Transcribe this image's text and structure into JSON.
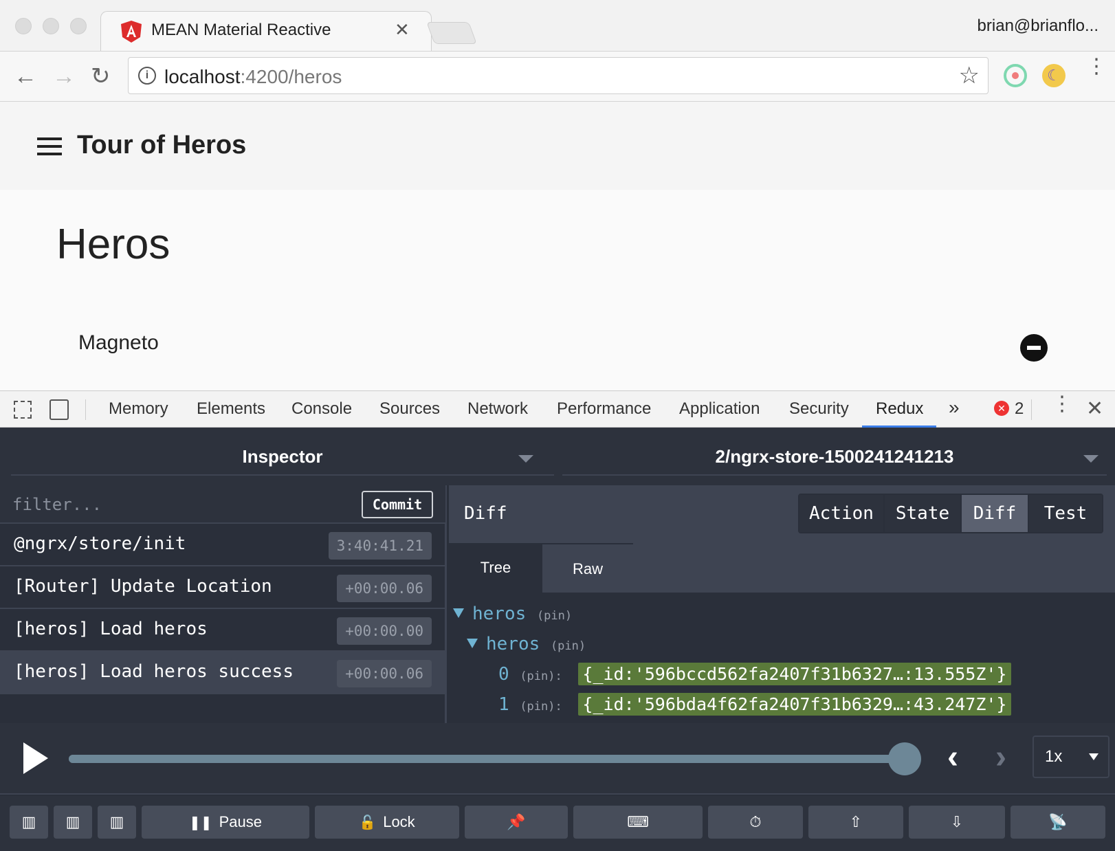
{
  "browser": {
    "tab_title": "MEAN Material Reactive",
    "tab_close": "✕",
    "profile": "brian@brianflo...",
    "url_host": "localhost",
    "url_path": ":4200/heros",
    "info_glyph": "i",
    "star_glyph": "☆",
    "back_glyph": "←",
    "forward_glyph": "→",
    "reload_glyph": "↻",
    "menu_glyph": "⋮",
    "ext2_glyph": "☾"
  },
  "app": {
    "title": "Tour of Heros",
    "heading": "Heros",
    "heroes": [
      "Magneto"
    ]
  },
  "devtools": {
    "tabs": [
      "Memory",
      "Elements",
      "Console",
      "Sources",
      "Network",
      "Performance",
      "Application",
      "Security",
      "Redux"
    ],
    "active_tab": "Redux",
    "overflow": "»",
    "error_count": "2",
    "error_glyph": "✕",
    "close_glyph": "✕",
    "menu_glyph": "⋮"
  },
  "redux": {
    "monitor": "Inspector",
    "instance": "2/ngrx-store-1500241241213",
    "filter_placeholder": "filter...",
    "commit_label": "Commit",
    "actions": [
      {
        "name": "@ngrx/store/init",
        "time": "3:40:41.21"
      },
      {
        "name": "[Router] Update Location",
        "time": "+00:00.06"
      },
      {
        "name": "[heros] Load heros",
        "time": "+00:00.00"
      },
      {
        "name": "[heros] Load heros success",
        "time": "+00:00.06"
      }
    ],
    "selected_action_index": 3,
    "pane_title": "Diff",
    "pane_tabs": [
      "Action",
      "State",
      "Diff",
      "Test"
    ],
    "active_pane_tab": "Diff",
    "view_tabs": [
      "Tree",
      "Raw"
    ],
    "active_view_tab": "Tree",
    "tree": {
      "root_key": "heros",
      "child_key": "heros",
      "pin_label": "(pin)",
      "items": [
        {
          "key": "0",
          "value": "{_id:'596bccd562fa2407f31b6327…:13.555Z'}"
        },
        {
          "key": "1",
          "value": "{_id:'596bda4f62fa2407f31b6329…:43.247Z'}"
        }
      ]
    },
    "slider_position": 1.0,
    "prev_glyph": "‹",
    "next_glyph": "›",
    "speed": "1x",
    "buttons": {
      "pause_label": "Pause",
      "lock_label": "Lock",
      "pause_glyph": "❚❚",
      "lock_glyph": "🔓",
      "pin_glyph": "📌",
      "keyboard_glyph": "⌨",
      "timer_glyph": "⏱",
      "upload_glyph": "⇧",
      "download_glyph": "⇩",
      "remote_glyph": "📡",
      "dock_glyph": "▥"
    }
  }
}
